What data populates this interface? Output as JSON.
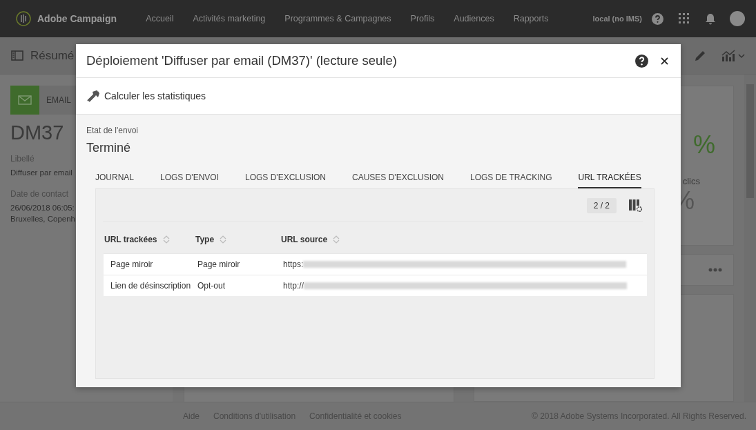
{
  "top_bar": {
    "brand": "Adobe Campaign",
    "nav": [
      {
        "label": "Accueil"
      },
      {
        "label": "Activités marketing"
      },
      {
        "label": "Programmes & Campagnes"
      },
      {
        "label": "Profils"
      },
      {
        "label": "Audiences"
      },
      {
        "label": "Rapports"
      }
    ],
    "instance": "local (no IMS)"
  },
  "page_header": {
    "title": "Résumé"
  },
  "summary": {
    "channel": "EMAIL",
    "code": "DM37",
    "fields": [
      {
        "label": "Libellé",
        "lines": [
          "Diffuser par email"
        ]
      },
      {
        "label": "Date de contact",
        "lines": [
          "26/06/2018 06:05:",
          "Bruxelles, Copenh"
        ]
      }
    ]
  },
  "stats": {
    "rate_1": "%",
    "label_2": "clics",
    "rate_2": "%"
  },
  "footer": {
    "links": [
      "Aide",
      "Conditions d'utilisation",
      "Confidentialité et cookies"
    ],
    "copyright": "© 2018 Adobe Systems Incorporated. All Rights Reserved."
  },
  "dialog": {
    "title": "Déploiement 'Diffuser par email (DM37)' (lecture seule)",
    "action": "Calculer les statistiques",
    "status_label": "Etat de l'envoi",
    "status": "Terminé",
    "tabs": [
      {
        "label": "JOURNAL",
        "selected": false
      },
      {
        "label": "LOGS D'ENVOI",
        "selected": false
      },
      {
        "label": "LOGS D'EXCLUSION",
        "selected": false
      },
      {
        "label": "CAUSES D'EXCLUSION",
        "selected": false
      },
      {
        "label": "LOGS DE TRACKING",
        "selected": false
      },
      {
        "label": "URL TRACKÉES",
        "selected": true
      }
    ],
    "count": "2 / 2",
    "table": {
      "columns": [
        "URL trackées",
        "Type",
        "URL source"
      ],
      "rows": [
        [
          "Page miroir",
          "Page miroir",
          "https:"
        ],
        [
          "Lien de désinscription",
          "Opt-out",
          "http://"
        ]
      ]
    }
  }
}
